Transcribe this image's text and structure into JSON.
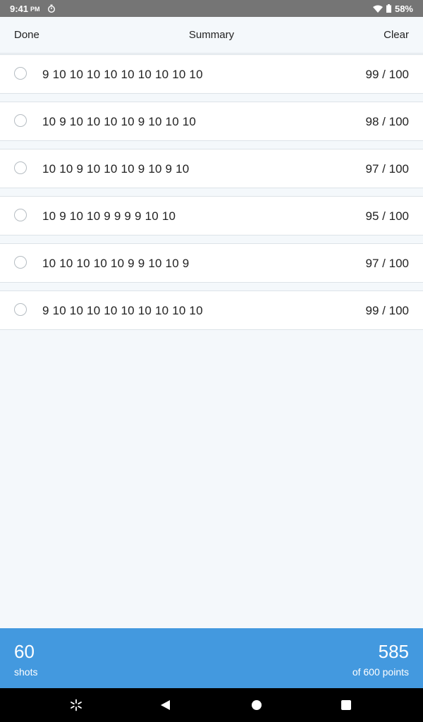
{
  "status_bar": {
    "time": "9:41",
    "ampm": "PM",
    "battery": "58%"
  },
  "header": {
    "done_label": "Done",
    "title": "Summary",
    "clear_label": "Clear"
  },
  "rows": [
    {
      "shots": "9 10 10 10 10 10 10 10 10 10",
      "score": "99 / 100"
    },
    {
      "shots": "10 9 10 10 10 10 9 10 10 10",
      "score": "98 / 100"
    },
    {
      "shots": "10 10 9 10 10 10 9 10 9 10",
      "score": "97 / 100"
    },
    {
      "shots": "10 9 10 10 9 9 9 9 10 10",
      "score": "95 / 100"
    },
    {
      "shots": "10 10 10 10 10 9 9 10 10 9",
      "score": "97 / 100"
    },
    {
      "shots": "9 10 10 10 10 10 10 10 10 10",
      "score": "99 / 100"
    }
  ],
  "footer": {
    "shots_count": "60",
    "shots_label": "shots",
    "points_total": "585",
    "points_label": "of 600 points"
  },
  "colors": {
    "accent": "#4399df",
    "status_bar": "#757575",
    "background": "#f4f8fb"
  },
  "icons": {
    "timer": "timer-icon",
    "wifi": "wifi-icon",
    "battery": "battery-icon",
    "nav_assistant": "sparkle-icon",
    "nav_back": "back-triangle-icon",
    "nav_home": "home-circle-icon",
    "nav_recents": "recents-square-icon"
  }
}
